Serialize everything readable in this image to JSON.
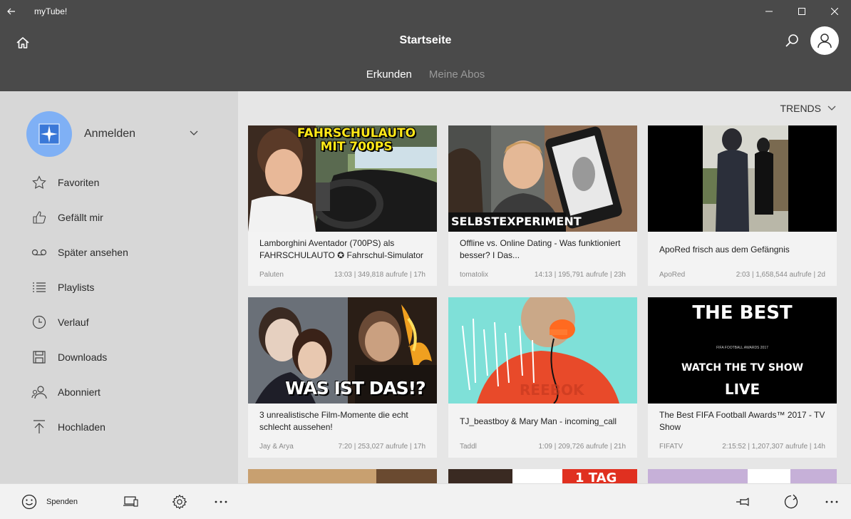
{
  "window": {
    "title": "myTube!"
  },
  "header": {
    "page_title": "Startseite",
    "tabs": [
      {
        "label": "Erkunden"
      },
      {
        "label": "Meine Abos"
      }
    ]
  },
  "sidebar": {
    "profile_label": "Anmelden",
    "items": [
      {
        "label": "Favoriten",
        "icon": "star-icon"
      },
      {
        "label": "Gefällt mir",
        "icon": "thumbs-up-icon"
      },
      {
        "label": "Später ansehen",
        "icon": "voicemail-icon"
      },
      {
        "label": "Playlists",
        "icon": "list-icon"
      },
      {
        "label": "Verlauf",
        "icon": "clock-icon"
      },
      {
        "label": "Downloads",
        "icon": "save-icon"
      },
      {
        "label": "Abonniert",
        "icon": "people-icon"
      },
      {
        "label": "Hochladen",
        "icon": "upload-icon"
      }
    ]
  },
  "main": {
    "filter_label": "TRENDS",
    "videos": [
      {
        "title": "Lamborghini Aventador (700PS) als FAHRSCHULAUTO ✪ Fahrschul-Simulator",
        "channel": "Paluten",
        "meta": "13:03 | 349,818 aufrufe  | 17h",
        "thumb_text": "FAHRSCHULAUTO\nMIT 700PS"
      },
      {
        "title": "Offline vs. Online Dating - Was funktioniert besser? I Das...",
        "channel": "tomatolix",
        "meta": "14:13 | 195,791 aufrufe  | 23h",
        "thumb_text": "SELBSTEXPERIMENT"
      },
      {
        "title": "ApoRed frisch aus dem Gefängnis",
        "channel": "ApoRed",
        "meta": "2:03 | 1,658,544 aufrufe  | 2d"
      },
      {
        "title": "3 unrealistische Film-Momente die echt schlecht aussehen!",
        "channel": "Jay & Arya",
        "meta": "7:20 | 253,027 aufrufe  | 17h",
        "thumb_text": "WAS IST DAS!?"
      },
      {
        "title": "TJ_beastboy & Mary Man - incoming_call",
        "channel": "Taddl",
        "meta": "1:09 | 209,726 aufrufe  | 21h",
        "thumb_text": "REEBOK"
      },
      {
        "title": "The Best FIFA Football Awards™ 2017 - TV Show",
        "channel": "FIFATV",
        "meta": "2:15:52 | 1,207,307 aufrufe  | 14h",
        "thumb_text_1": "THE BEST",
        "thumb_text_2": "FIFA FOOTBALL AWARDS 2017",
        "thumb_text_3": "WATCH THE TV SHOW",
        "thumb_text_4": "LIVE"
      }
    ],
    "partial_thumb_text": "1 TAG"
  },
  "bottombar": {
    "donate_label": "Spenden"
  }
}
